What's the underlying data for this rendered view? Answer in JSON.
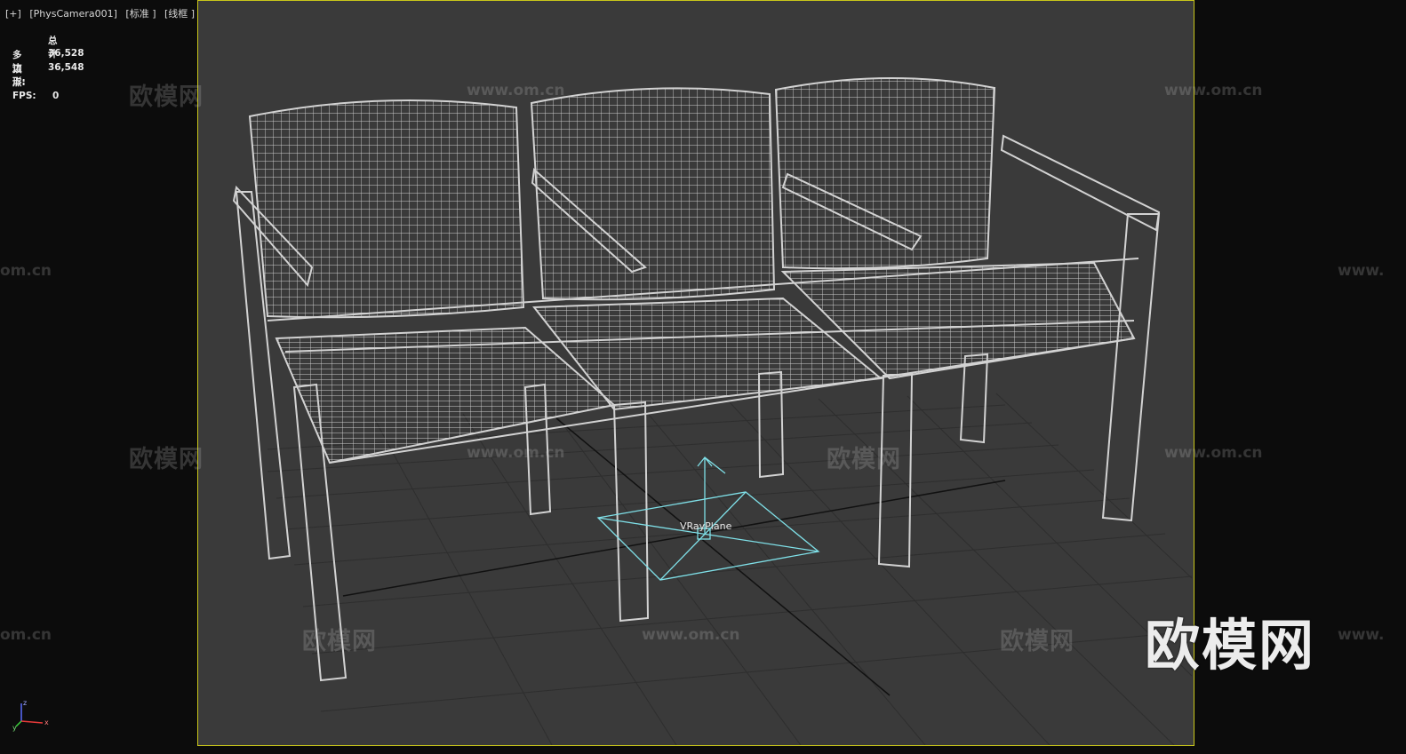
{
  "viewport_label": {
    "plus": "[+]",
    "camera": "[PhysCamera001]",
    "shading_mode": "[标准 ]",
    "display_mode": "[线框 ]"
  },
  "stats": {
    "header": "总计",
    "polygons_label": "多边形:",
    "polygons_value": "36,528",
    "vertices_label": "顶点:",
    "vertices_value": "36,548",
    "fps_label": "FPS:",
    "fps_value": "0"
  },
  "scene": {
    "object_label": "VRayPlane",
    "wireframe_color": "#d2d2d2",
    "gizmo_color": "#7fe0e8",
    "viewport_border_color": "#c9c71a"
  },
  "watermarks": {
    "site_cn": "欧模网",
    "site_url": "www.om.cn",
    "site_url_partial": "om.cn",
    "site_url_prefix": "www."
  },
  "logo_text": "欧模网",
  "axis_tripod": {
    "x": "x",
    "y": "y",
    "z": "z"
  }
}
